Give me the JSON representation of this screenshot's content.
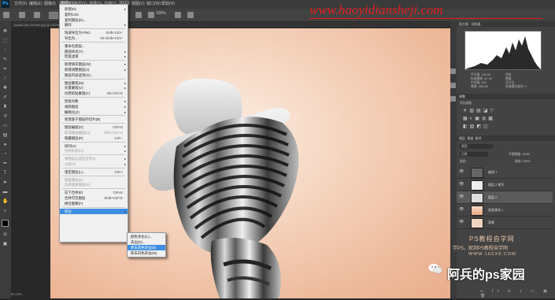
{
  "app": {
    "logo": "Ps"
  },
  "menubar": {
    "items": [
      "文件(F)",
      "编辑(E)",
      "图像(I)",
      "图层(L)",
      "类型(Y)",
      "选择(S)",
      "滤镜(T)",
      "3D(D)",
      "视图(V)",
      "窗口(W)",
      "帮助(H)"
    ],
    "active_index": 3
  },
  "options": {
    "zoom": "100%"
  },
  "document": {
    "tab1": "aaaaa-dsc-chrome.jpg @ 100%(RGB/8#)",
    "tab2": "图层1",
    "status": "50.19%"
  },
  "layer_menu": {
    "items": [
      {
        "label": "新建(N)",
        "shortcut": "",
        "submenu": true
      },
      {
        "label": "复制CSS",
        "shortcut": "",
        "submenu": false
      },
      {
        "label": "复制图层(D)...",
        "shortcut": "",
        "submenu": false
      },
      {
        "label": "删除",
        "shortcut": "",
        "submenu": true
      },
      {
        "sep": true
      },
      {
        "label": "快速导出为 PNG",
        "shortcut": "Shift+Ctrl+'",
        "submenu": false
      },
      {
        "label": "导出为...",
        "shortcut": "Alt+Shift+Ctrl+'",
        "submenu": false
      },
      {
        "sep": true
      },
      {
        "label": "重命名图层...",
        "shortcut": "",
        "submenu": false
      },
      {
        "label": "图层样式(Y)",
        "shortcut": "",
        "submenu": true
      },
      {
        "label": "智能滤镜",
        "shortcut": "",
        "submenu": true
      },
      {
        "sep": true
      },
      {
        "label": "新建填充图层(W)",
        "shortcut": "",
        "submenu": true
      },
      {
        "label": "新建调整图层(J)",
        "shortcut": "",
        "submenu": true
      },
      {
        "label": "图层内容选项(O)...",
        "shortcut": "",
        "submenu": false
      },
      {
        "sep": true
      },
      {
        "label": "图层蒙版(M)",
        "shortcut": "",
        "submenu": true
      },
      {
        "label": "矢量蒙版(V)",
        "shortcut": "",
        "submenu": true
      },
      {
        "label": "创建剪贴蒙版(C)",
        "shortcut": "Alt+Ctrl+G",
        "submenu": false
      },
      {
        "sep": true
      },
      {
        "label": "智能对象",
        "shortcut": "",
        "submenu": true
      },
      {
        "label": "视频图层",
        "shortcut": "",
        "submenu": true
      },
      {
        "label": "栅格化(Z)",
        "shortcut": "",
        "submenu": true
      },
      {
        "sep": true
      },
      {
        "label": "新建基于图层的切片(B)",
        "shortcut": "",
        "submenu": false
      },
      {
        "sep": true
      },
      {
        "label": "图层编组(G)",
        "shortcut": "Ctrl+G",
        "submenu": false
      },
      {
        "label": "取消图层编组(U)",
        "shortcut": "Shift+Ctrl+G",
        "submenu": false,
        "disabled": true
      },
      {
        "label": "隐藏图层(R)",
        "shortcut": "Ctrl+,",
        "submenu": false
      },
      {
        "sep": true
      },
      {
        "label": "排列(A)",
        "shortcut": "",
        "submenu": true
      },
      {
        "label": "合并形状(H)",
        "shortcut": "",
        "submenu": true,
        "disabled": true
      },
      {
        "sep": true
      },
      {
        "label": "将图层与选区对齐(I)",
        "shortcut": "",
        "submenu": true,
        "disabled": true
      },
      {
        "label": "分布(T)",
        "shortcut": "",
        "submenu": true,
        "disabled": true
      },
      {
        "sep": true
      },
      {
        "label": "锁定图层(L)...",
        "shortcut": "Ctrl+/",
        "submenu": false
      },
      {
        "sep": true
      },
      {
        "label": "链接图层(K)",
        "shortcut": "",
        "submenu": false,
        "disabled": true
      },
      {
        "label": "选择链接图层(S)",
        "shortcut": "",
        "submenu": false,
        "disabled": true
      },
      {
        "sep": true
      },
      {
        "label": "向下合并(E)",
        "shortcut": "Ctrl+E",
        "submenu": false
      },
      {
        "label": "合并可见图层",
        "shortcut": "Shift+Ctrl+E",
        "submenu": false
      },
      {
        "label": "拼合图像(F)",
        "shortcut": "",
        "submenu": false
      },
      {
        "sep": true
      },
      {
        "label": "修边",
        "shortcut": "",
        "submenu": true,
        "highlighted": true
      }
    ]
  },
  "matting_submenu": {
    "items": [
      "颜色净化(C)...",
      "去边(D)...",
      "移去黑色杂边(B)",
      "移去白色杂边(W)"
    ],
    "highlighted_index": 2
  },
  "panels": {
    "histogram": {
      "tab1": "直方图",
      "tab2": "导航器",
      "stats_left": [
        "平均值: 182.65",
        "标准偏差: 62.39",
        "中间值: 200",
        "像素: 361184"
      ],
      "stats_right": [
        "色阶:",
        "数量:",
        "百分位:",
        "高速缓存级别: 4"
      ]
    },
    "adjust": {
      "title": "调整",
      "subtitle": "添加调整"
    },
    "layers": {
      "tabs": [
        "图层",
        "通道",
        "路径"
      ],
      "filter": "类型",
      "blend": "正常",
      "opacity": "不透明度: 100%",
      "fill": "填充: 100%",
      "lock": "锁定:",
      "items": [
        {
          "name": "曲线 1",
          "selected": false
        },
        {
          "name": "图层 2 拷贝",
          "selected": false
        },
        {
          "name": "图层 2",
          "selected": true
        },
        {
          "name": "渐变填充 1",
          "selected": false
        },
        {
          "name": "背景",
          "selected": false
        }
      ]
    }
  },
  "watermarks": {
    "url": "www.haoyidiansheji.com",
    "ps_title": "PS教程自学网",
    "ps_sub": "学PS，就到PS教程自学网",
    "ps_url": "WWW.16XX8.COM",
    "account": "阿兵的ps家园"
  },
  "colors": {
    "menu_highlight": "#3d8ee0",
    "watermark_red": "#e41f1f",
    "canvas_bg": "#f6d7c2"
  }
}
